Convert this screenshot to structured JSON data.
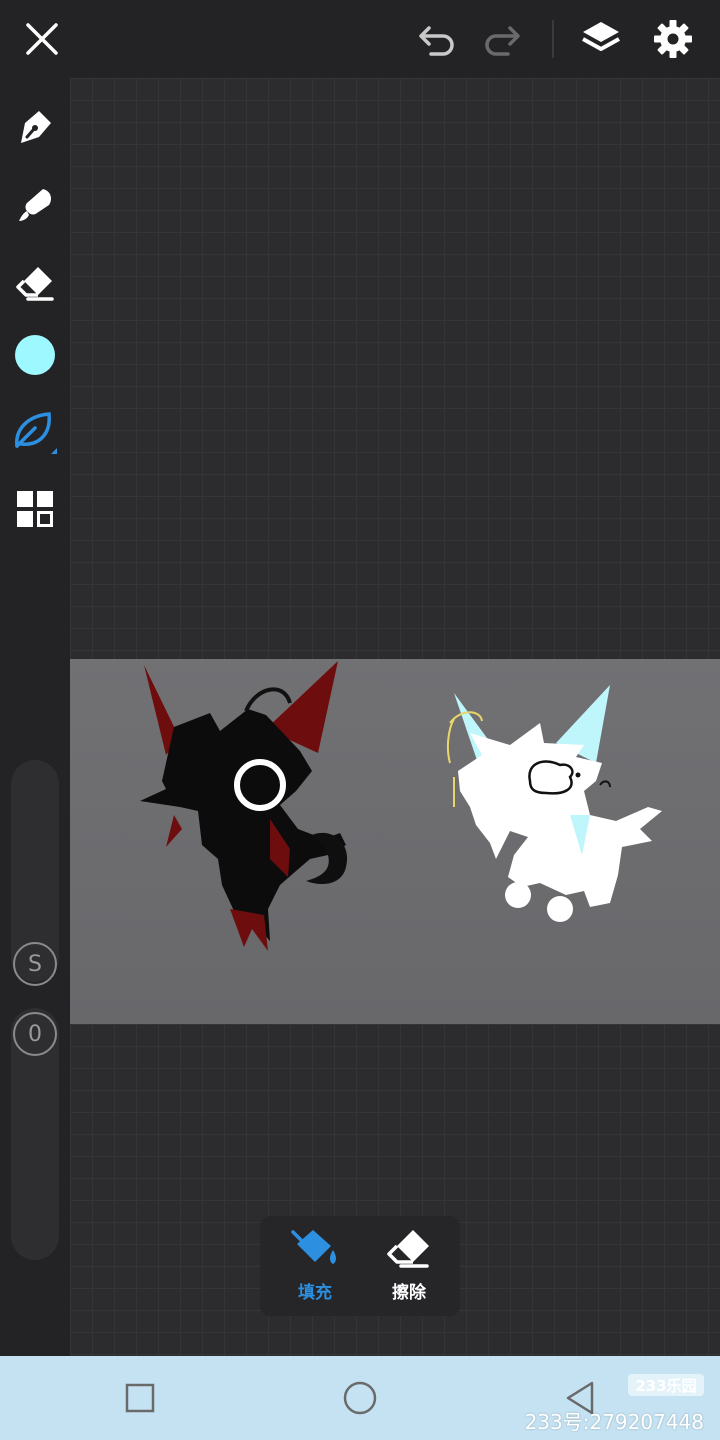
{
  "topbar": {
    "icons": [
      "close-icon",
      "undo-icon",
      "redo-icon",
      "layers-icon",
      "settings-icon"
    ]
  },
  "sidebar": {
    "tools": [
      "pen-icon",
      "brush-icon",
      "eraser-icon",
      "color-swatch",
      "leaf-brush-icon",
      "grid-icon"
    ],
    "current_color": "#9ef8ff",
    "active_tool_color": "#2d8fe0",
    "size_label": "S",
    "opacity_label": "0"
  },
  "fill_popup": {
    "fill_label": "填充",
    "erase_label": "擦除",
    "active_color": "#2d8fe0"
  },
  "navbar": {
    "icons": [
      "square-icon",
      "circle-icon",
      "back-triangle-icon"
    ]
  },
  "watermark": {
    "badge": "233乐园",
    "text": "233号:279207448"
  }
}
